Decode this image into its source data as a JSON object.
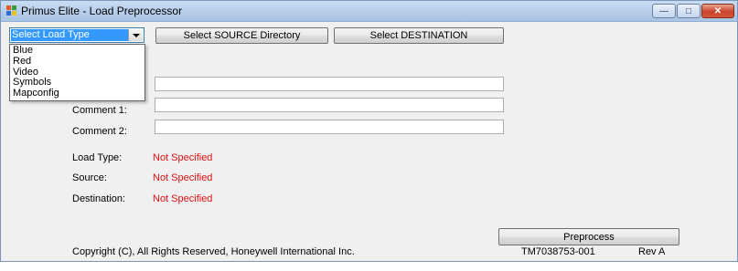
{
  "window": {
    "title": "Primus Elite - Load Preprocessor",
    "controls": {
      "minimize": "—",
      "maximize": "□",
      "close": "✕"
    }
  },
  "load_type_combo": {
    "selected": "Select Load Type",
    "options": [
      "Blue",
      "Red",
      "Video",
      "Symbols",
      "Mapconfig"
    ]
  },
  "buttons": {
    "select_source": "Select SOURCE Directory",
    "select_destination": "Select DESTINATION",
    "preprocess": "Preprocess"
  },
  "fields": {
    "comment1_label": "Comment 1:",
    "comment2_label": "Comment 2:",
    "comment1_value": "",
    "comment2_value": "",
    "top_value": ""
  },
  "status": {
    "load_type_label": "Load Type:",
    "load_type_value": "Not Specified",
    "source_label": "Source:",
    "source_value": "Not Specified",
    "destination_label": "Destination:",
    "destination_value": "Not Specified"
  },
  "footer": {
    "copyright": "Copyright (C), All Rights Reserved, Honeywell International Inc.",
    "part_number": "TM7038753-001",
    "revision": "Rev A"
  },
  "colors": {
    "status_red": "#e01010",
    "selection_blue": "#3399ff"
  }
}
